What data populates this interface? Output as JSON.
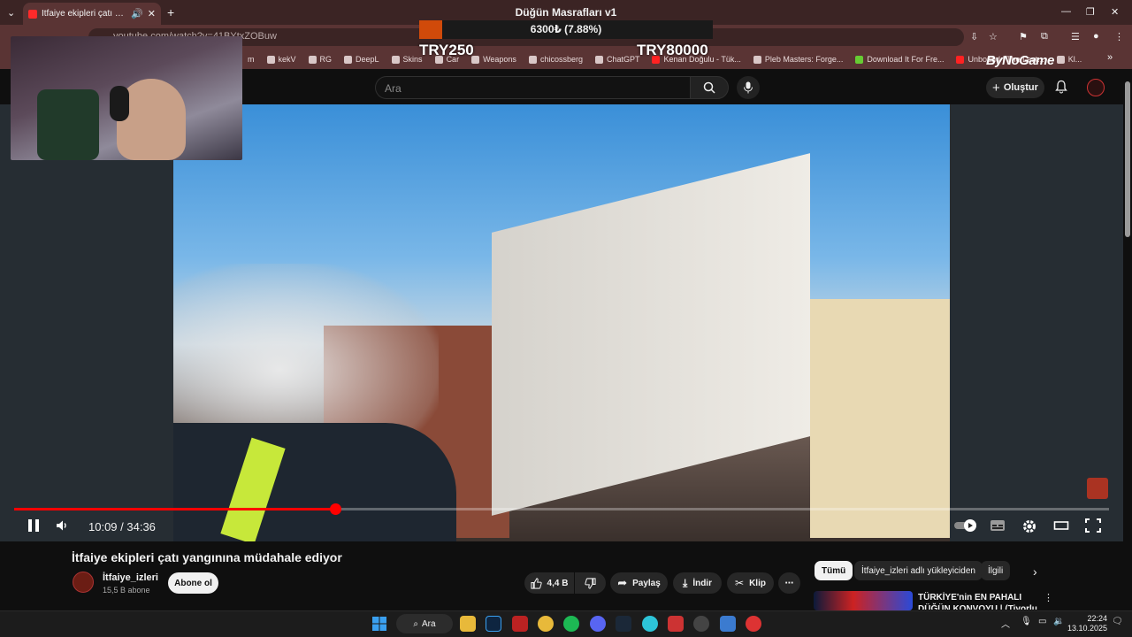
{
  "browser": {
    "tab_title": "İtfaiye ekipleri çatı yangınına müdahale ediyor",
    "url": "youtube.com/watch?v=41BYtxZOBuw",
    "bookmarks": [
      "m",
      "kekV",
      "RG",
      "DeepL",
      "Skins",
      "Car",
      "Weapons",
      "chicossberg",
      "ChatGPT",
      "Kenan Doğulu - Tük...",
      "Pleb Masters: Forge...",
      "Download It For Fre...",
      "Unbound | The Last...",
      "Kl..."
    ]
  },
  "overlay": {
    "title": "Düğün Masrafları v1",
    "progress_text": "6300₺ (7.88%)",
    "progress_fraction": 0.0788,
    "min_label": "TRY250",
    "max_label": "TRY80000",
    "brand": "ByNoGame"
  },
  "youtube": {
    "search_placeholder": "Ara",
    "create_label": "Oluştur",
    "player": {
      "time_display": "10:09 / 34:36",
      "progress_fraction": 0.2929
    },
    "video_title": "İtfaiye ekipleri çatı yangınına müdahale ediyor",
    "channel": {
      "name": "İtfaiye_izleri",
      "subscribers": "15,5 B abone",
      "subscribe_label": "Abone ol"
    },
    "actions": {
      "likes": "4,4 B",
      "share": "Paylaş",
      "download": "İndir",
      "clip": "Klip"
    },
    "filters": [
      "Tümü",
      "İtfaiye_izleri adlı yükleyiciden",
      "İlgili"
    ],
    "recommendation": {
      "title": "TÜRKİYE'nin EN PAHALI DÜĞÜN KONVOYU | (Tiyorlu İsmail"
    }
  },
  "taskbar": {
    "search_label": "Ara",
    "time": "22:24",
    "date": "13.10.2025"
  },
  "colors": {
    "accent": "#ff0000",
    "overlay_fill": "#d04a0a",
    "chrome": "#5a3434"
  }
}
